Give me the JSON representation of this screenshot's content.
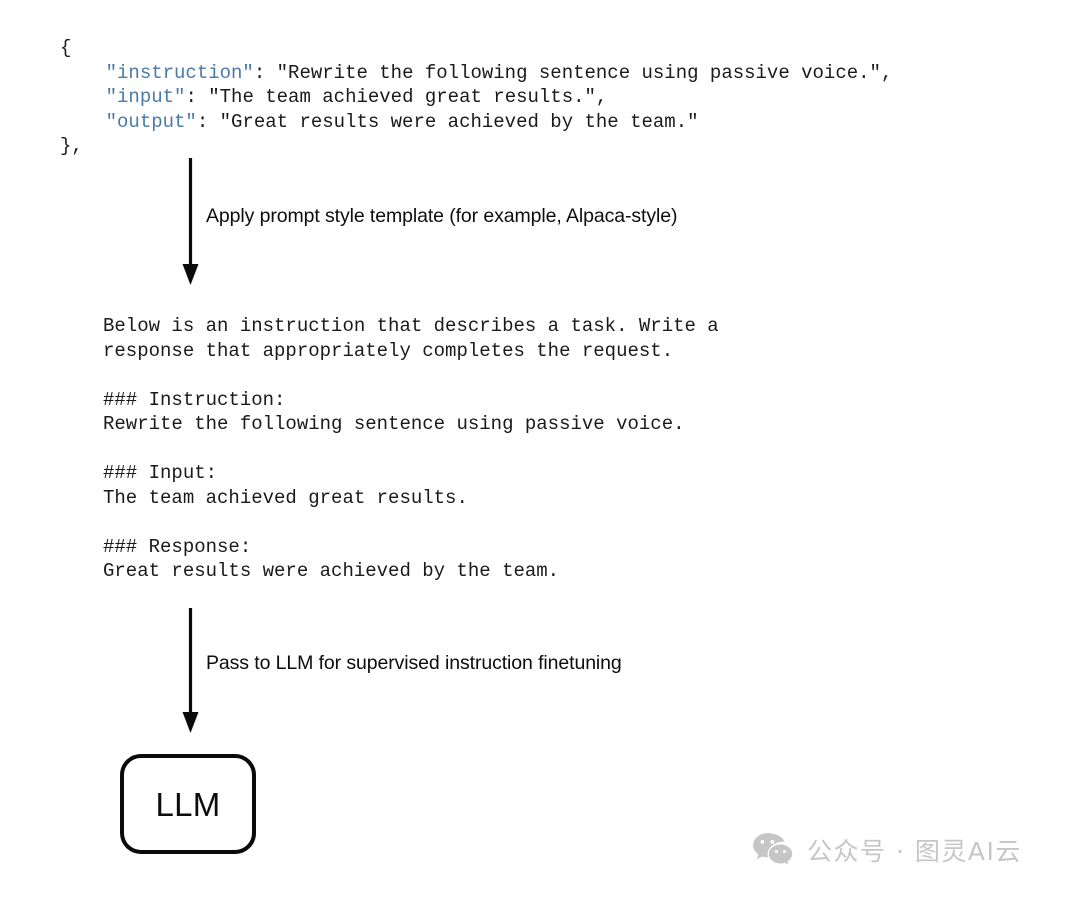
{
  "figure": {
    "background_color": "#ffffff",
    "text_color": "#1a1a1a",
    "accent_color": "#4a7ba8",
    "watermark_color": "#c6c6c6"
  },
  "json_sample": {
    "open_brace": "{",
    "close_brace": "},",
    "entries": [
      {
        "key": "\"instruction\"",
        "value": ": \"Rewrite the following sentence using passive voice.\","
      },
      {
        "key": "\"input\"",
        "value": ": \"The team achieved great results.\","
      },
      {
        "key": "\"output\"",
        "value": ": \"Great results were achieved by the team.\""
      }
    ]
  },
  "arrows": [
    {
      "label": "Apply prompt style template (for example, Alpaca-style)"
    },
    {
      "label": "Pass to LLM for supervised instruction finetuning"
    }
  ],
  "prompt_block": {
    "lines": [
      "Below is an instruction that describes a task. Write a",
      "response that appropriately completes the request.",
      "",
      "### Instruction:",
      "Rewrite the following sentence using passive voice.",
      "",
      "### Input:",
      "The team achieved great results.",
      "",
      "### Response:",
      "Great results were achieved by the team."
    ],
    "text": "Below is an instruction that describes a task. Write a\nresponse that appropriately completes the request.\n\n### Instruction:\nRewrite the following sentence using passive voice.\n\n### Input:\nThe team achieved great results.\n\n### Response:\nGreat results were achieved by the team."
  },
  "llm_node": {
    "label": "LLM"
  },
  "watermark": {
    "icon": "wechat-icon",
    "text": "公众号 · 图灵AI云"
  }
}
